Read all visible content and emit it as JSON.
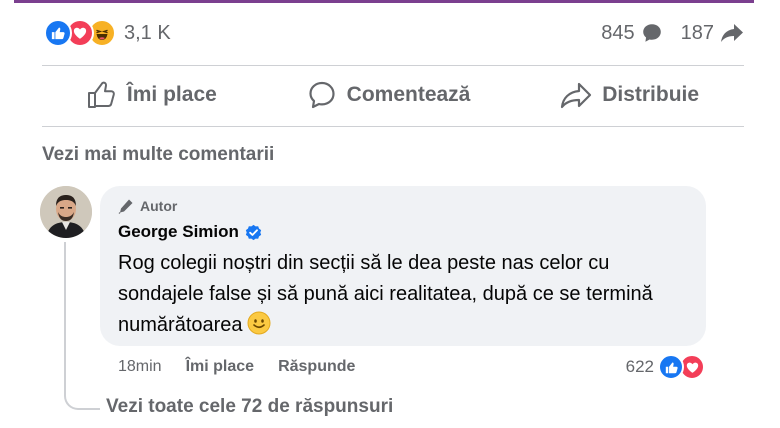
{
  "post_stats": {
    "reaction_count": "3,1 K",
    "comment_count": "845",
    "share_count": "187",
    "reaction_types": [
      "like-icon",
      "love-icon",
      "haha-icon"
    ]
  },
  "actions": {
    "like_label": "Îmi place",
    "comment_label": "Comentează",
    "share_label": "Distribuie"
  },
  "comments_section": {
    "more_comments_label": "Vezi mai multe comentarii"
  },
  "comment": {
    "badge_label": "Autor",
    "author_name": "George Simion",
    "verified": true,
    "text": "Rog colegii noștri din secții să le dea peste nas celor cu sondajele false și să pună aici realitatea, după ce se termină numărătoarea",
    "time": "18min",
    "like_label": "Îmi place",
    "reply_label": "Răspunde",
    "reaction_count": "622",
    "reaction_types": [
      "like-icon",
      "love-icon"
    ]
  },
  "replies": {
    "label": "Vezi toate cele 72 de răspunsuri"
  },
  "colors": {
    "accent_blue": "#1877f2",
    "love_red": "#f33e58",
    "muted_text": "#65676b",
    "bubble_bg": "#f0f2f5",
    "top_accent": "#7b3f8f"
  }
}
